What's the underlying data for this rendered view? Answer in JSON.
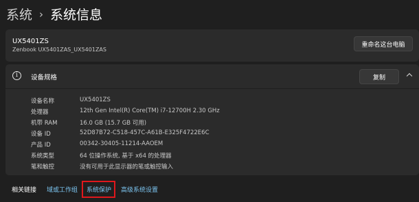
{
  "breadcrumb": {
    "parent": "系统",
    "separator": "›",
    "current": "系统信息"
  },
  "device": {
    "name": "UX5401ZS",
    "model": "Zenbook UX5401ZAS_UX5401ZAS",
    "rename_button": "重命名这台电脑"
  },
  "specs": {
    "title": "设备规格",
    "copy_button": "复制",
    "rows": [
      {
        "label": "设备名称",
        "value": "UX5401ZS"
      },
      {
        "label": "处理器",
        "value": "12th Gen Intel(R) Core(TM) i7-12700H   2.30 GHz"
      },
      {
        "label": "机带 RAM",
        "value": "16.0 GB (15.7 GB 可用)"
      },
      {
        "label": "设备 ID",
        "value": "52D87B72-C518-457C-A61B-E325F4722E6C"
      },
      {
        "label": "产品 ID",
        "value": "00342-30405-11214-AAOEM"
      },
      {
        "label": "系统类型",
        "value": "64 位操作系统, 基于 x64 的处理器"
      },
      {
        "label": "笔和触控",
        "value": "没有可用于此显示器的笔或触控输入"
      }
    ]
  },
  "related": {
    "label": "相关链接",
    "links": [
      "域或工作组",
      "系统保护",
      "高级系统设置"
    ]
  },
  "colors": {
    "background": "#1f1f1f",
    "card": "#2b2b2b",
    "link": "#7cc5f0",
    "highlight": "#e0171c"
  },
  "icons": {
    "info": "info-circle-icon",
    "expand": "chevron-up-icon",
    "separator": "chevron-right-icon"
  }
}
